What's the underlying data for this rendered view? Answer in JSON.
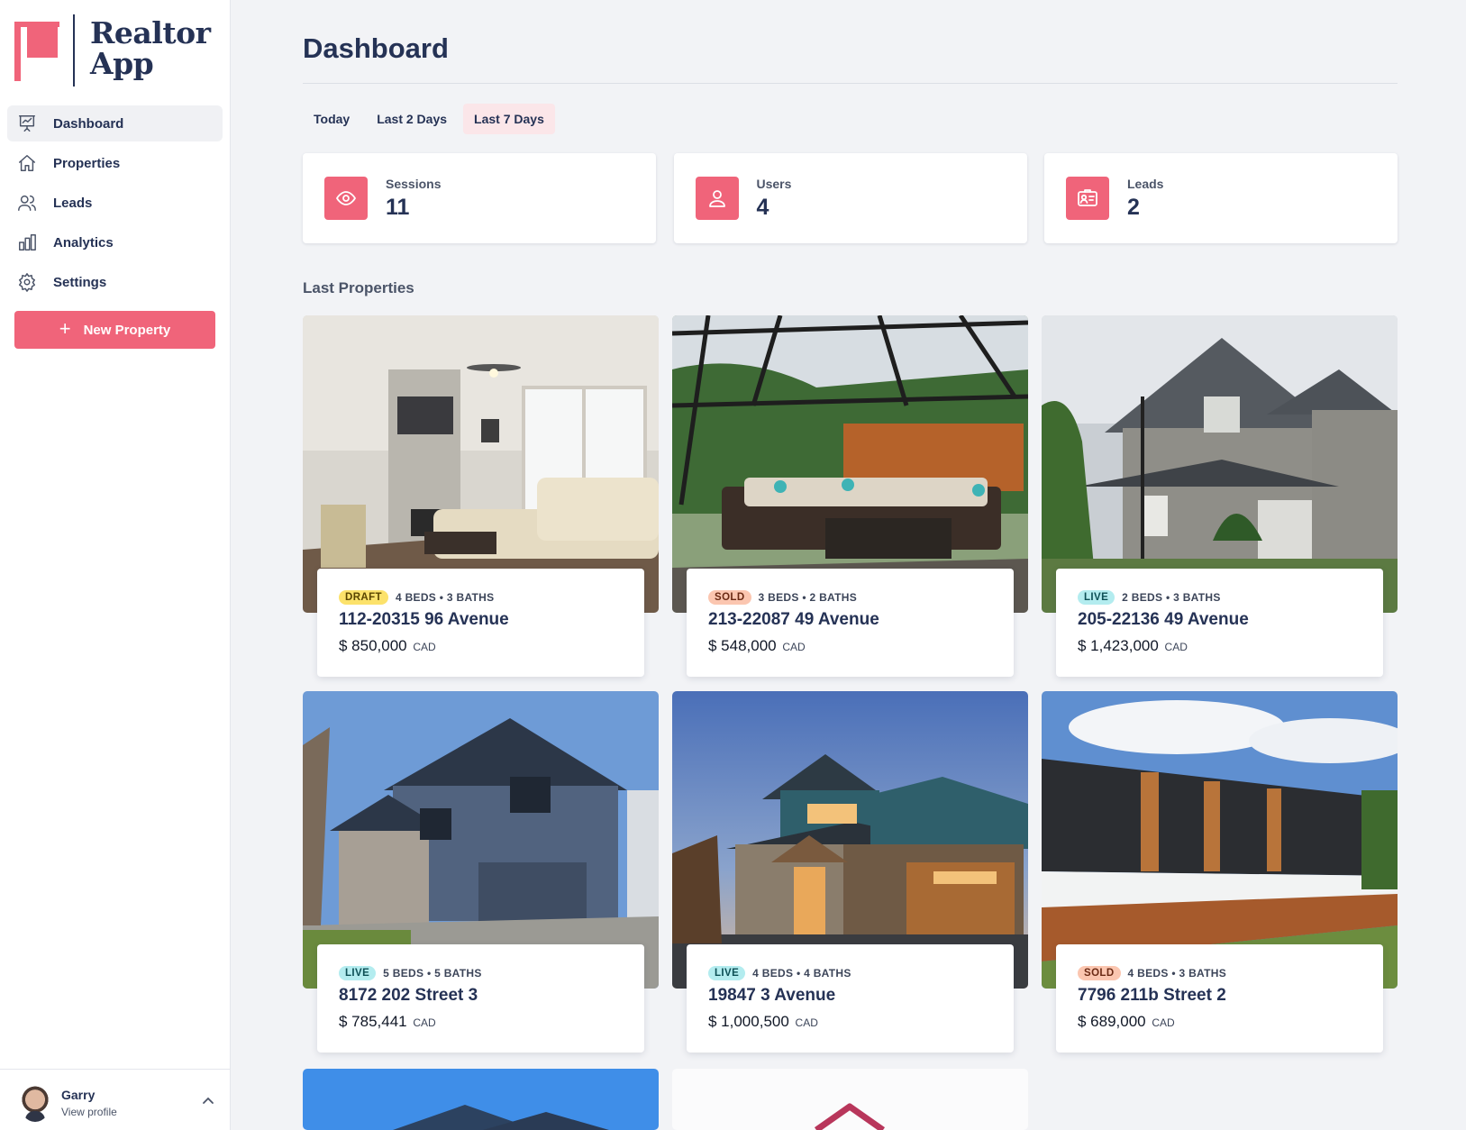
{
  "app": {
    "name_line1": "Realtor",
    "name_line2": "App"
  },
  "sidebar": {
    "items": [
      {
        "label": "Dashboard",
        "icon": "presentation-chart-icon",
        "active": true
      },
      {
        "label": "Properties",
        "icon": "home-icon",
        "active": false
      },
      {
        "label": "Leads",
        "icon": "users-icon",
        "active": false
      },
      {
        "label": "Analytics",
        "icon": "bar-chart-icon",
        "active": false
      },
      {
        "label": "Settings",
        "icon": "gear-icon",
        "active": false
      }
    ],
    "new_button": "New Property"
  },
  "profile": {
    "name": "Garry",
    "link": "View profile"
  },
  "page": {
    "title": "Dashboard"
  },
  "tabs": [
    {
      "label": "Today",
      "active": false
    },
    {
      "label": "Last 2 Days",
      "active": false
    },
    {
      "label": "Last 7 Days",
      "active": true
    }
  ],
  "stats": [
    {
      "label": "Sessions",
      "value": "11",
      "icon": "eye-icon"
    },
    {
      "label": "Users",
      "value": "4",
      "icon": "users-icon"
    },
    {
      "label": "Leads",
      "value": "2",
      "icon": "id-card-icon"
    }
  ],
  "section": {
    "title": "Last Properties"
  },
  "properties": [
    {
      "status": "DRAFT",
      "details": "4 BEDS • 3 BATHS",
      "address": "112-20315 96 Avenue",
      "price": "$ 850,000",
      "currency": "CAD",
      "image": "living-room-photo"
    },
    {
      "status": "SOLD",
      "details": "3 BEDS • 2 BATHS",
      "address": "213-22087 49 Avenue",
      "price": "$ 548,000",
      "currency": "CAD",
      "image": "patio-photo"
    },
    {
      "status": "LIVE",
      "details": "2 BEDS • 3 BATHS",
      "address": "205-22136 49 Avenue",
      "price": "$ 1,423,000",
      "currency": "CAD",
      "image": "grey-house-photo"
    },
    {
      "status": "LIVE",
      "details": "5 BEDS • 5 BATHS",
      "address": "8172 202 Street 3",
      "price": "$ 785,441",
      "currency": "CAD",
      "image": "blue-house-photo"
    },
    {
      "status": "LIVE",
      "details": "4 BEDS • 4 BATHS",
      "address": "19847 3 Avenue",
      "price": "$ 1,000,500",
      "currency": "CAD",
      "image": "dusk-house-photo"
    },
    {
      "status": "SOLD",
      "details": "4 BEDS • 3 BATHS",
      "address": "7796 211b Street 2",
      "price": "$ 689,000",
      "currency": "CAD",
      "image": "townhouses-photo"
    }
  ],
  "colors": {
    "accent": "#f0647a",
    "navy": "#253255",
    "background": "#f2f3f6"
  }
}
